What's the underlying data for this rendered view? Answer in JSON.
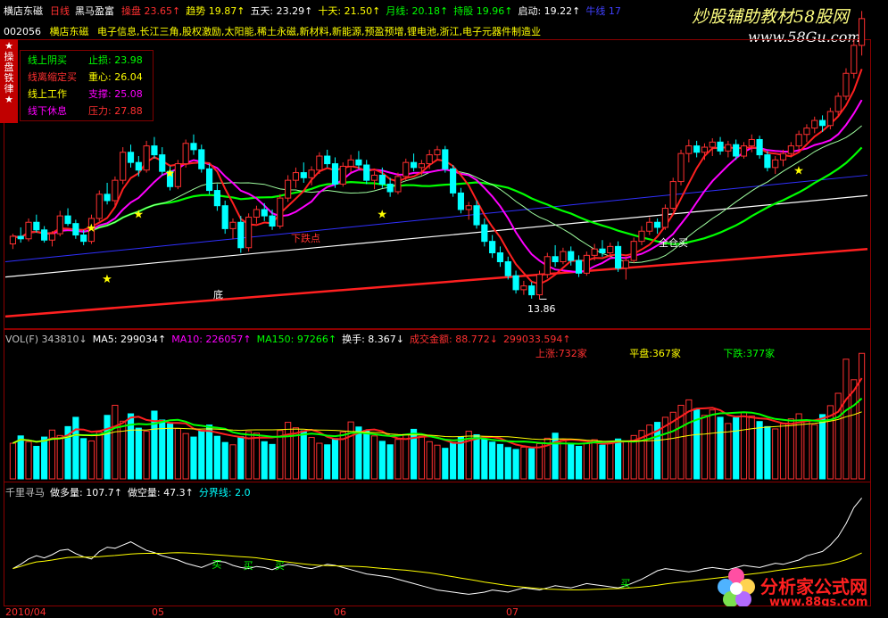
{
  "colors": {
    "up": "#ff3030",
    "down": "#00ffff",
    "bg": "#000000",
    "grid": "#8b0000",
    "white": "#ffffff",
    "yellow": "#ffff00",
    "green": "#00ff00",
    "magenta": "#ff00ff",
    "blue": "#4040ff"
  },
  "topbar": {
    "stock_name": "横店东磁",
    "period": "日线",
    "indicator_name": "黑马盈富",
    "items": [
      {
        "label": "操盘",
        "value": "23.65↑",
        "color": "#ff3030"
      },
      {
        "label": "趋势",
        "value": "19.87↑",
        "color": "#ffff00"
      },
      {
        "label": "五天:",
        "value": "23.29↑",
        "color": "#ffffff"
      },
      {
        "label": "十天:",
        "value": "21.50↑",
        "color": "#ffff00"
      },
      {
        "label": "月线:",
        "value": "20.18↑",
        "color": "#00ff00"
      },
      {
        "label": "持股",
        "value": "19.96↑",
        "color": "#00ff00"
      },
      {
        "label": "启动:",
        "value": "19.22↑",
        "color": "#ffffff"
      },
      {
        "label": "牛线",
        "value": "17",
        "color": "#4040ff"
      }
    ],
    "watermark": "炒股辅助教材58股网",
    "watermark_url": "www.58Gu.com"
  },
  "infobar": {
    "code": "002056",
    "name": "横店东磁",
    "tags": "电子信息,长江三角,股权激励,太阳能,稀土永磁,新材料,新能源,预盈预增,锂电池,浙江,电子元器件制造业"
  },
  "badge": {
    "chars": [
      "★",
      "操",
      "盘",
      "铁",
      "律",
      "★"
    ]
  },
  "rules": [
    {
      "left": "线上阴买",
      "right_label": "止损:",
      "right_value": "23.98",
      "left_color": "#00ff00",
      "right_color": "#00ff00"
    },
    {
      "left": "线离缩定买",
      "right_label": "重心:",
      "right_value": "26.04",
      "left_color": "#ff3030",
      "right_color": "#ffff00"
    },
    {
      "left": "线上工作",
      "right_label": "支撑:",
      "right_value": "25.08",
      "left_color": "#ffff00",
      "right_color": "#ff00ff"
    },
    {
      "left": "线下休息",
      "right_label": "压力:",
      "right_value": "27.88",
      "left_color": "#ff00ff",
      "right_color": "#ff3030"
    }
  ],
  "annotations": {
    "bottom_label": "底",
    "low_price": "13.86",
    "buy_label": "全仓买",
    "other_label": "下跌点",
    "mark_buy": "买"
  },
  "vol_header": {
    "items": [
      {
        "label": "VOL(F)",
        "value": "343810↓",
        "color": "#c0c0c0"
      },
      {
        "label": "MA5:",
        "value": "299034↑",
        "color": "#ffffff"
      },
      {
        "label": "MA10:",
        "value": "226057↑",
        "color": "#ff00ff"
      },
      {
        "label": "MA150:",
        "value": "97266↑",
        "color": "#00ff00"
      },
      {
        "label": "换手:",
        "value": "8.367↓",
        "color": "#ffffff"
      },
      {
        "label": "成交金额:",
        "value": "88.772↓",
        "color": "#ff3030"
      },
      {
        "label": "",
        "value": "299033.594↑",
        "color": "#ff3030"
      }
    ],
    "breadth": [
      {
        "text": "上涨:732家",
        "color": "#ff3030"
      },
      {
        "text": "平盘:367家",
        "color": "#ffff00"
      },
      {
        "text": "下跌:377家",
        "color": "#00ff00"
      }
    ]
  },
  "osc_header": {
    "items": [
      {
        "label": "千里寻马",
        "value": "",
        "color": "#c0c0c0"
      },
      {
        "label": "做多量:",
        "value": "107.7↑",
        "color": "#ffffff"
      },
      {
        "label": "做空量:",
        "value": "47.3↑",
        "color": "#ffffff"
      },
      {
        "label": "分界线:",
        "value": "2.0",
        "color": "#00ffff"
      }
    ],
    "buy_marks": [
      "买",
      "买",
      "买",
      "买"
    ],
    "logo_text": "分析家公式网",
    "logo_url": "www.88gs.com"
  },
  "x_axis": {
    "labels": [
      "2010/04",
      "05",
      "06",
      "07"
    ]
  },
  "chart_data": {
    "type": "candlestick",
    "ylim": [
      12,
      34
    ],
    "candles": [
      [
        18.2,
        19.0,
        17.8,
        18.8
      ],
      [
        18.8,
        19.5,
        18.3,
        18.6
      ],
      [
        18.6,
        20.2,
        18.4,
        19.9
      ],
      [
        19.9,
        20.5,
        19.1,
        19.3
      ],
      [
        19.3,
        19.6,
        18.3,
        18.5
      ],
      [
        18.5,
        19.2,
        18.0,
        19.0
      ],
      [
        19.0,
        20.8,
        18.8,
        20.4
      ],
      [
        20.4,
        21.0,
        19.6,
        19.8
      ],
      [
        19.8,
        20.1,
        18.6,
        18.9
      ],
      [
        18.9,
        19.3,
        18.1,
        18.4
      ],
      [
        18.4,
        20.5,
        18.2,
        20.2
      ],
      [
        20.2,
        22.4,
        20.0,
        22.1
      ],
      [
        22.1,
        23.0,
        21.3,
        21.6
      ],
      [
        21.6,
        23.5,
        21.2,
        23.2
      ],
      [
        23.2,
        25.8,
        22.9,
        25.4
      ],
      [
        25.4,
        26.0,
        24.2,
        24.6
      ],
      [
        24.6,
        25.1,
        23.5,
        24.0
      ],
      [
        24.0,
        26.3,
        23.8,
        25.9
      ],
      [
        25.9,
        26.6,
        24.9,
        25.2
      ],
      [
        25.2,
        25.8,
        23.6,
        23.9
      ],
      [
        23.9,
        24.3,
        22.4,
        22.7
      ],
      [
        22.7,
        24.8,
        22.5,
        24.5
      ],
      [
        24.5,
        26.4,
        24.2,
        26.1
      ],
      [
        26.1,
        26.8,
        25.2,
        25.6
      ],
      [
        25.6,
        26.0,
        23.8,
        24.1
      ],
      [
        24.1,
        24.5,
        22.1,
        22.4
      ],
      [
        22.4,
        22.9,
        20.8,
        21.2
      ],
      [
        21.2,
        21.6,
        19.0,
        19.4
      ],
      [
        19.4,
        20.2,
        18.6,
        19.9
      ],
      [
        19.9,
        20.4,
        17.5,
        17.9
      ],
      [
        17.9,
        20.6,
        17.6,
        20.3
      ],
      [
        20.3,
        21.2,
        19.8,
        20.9
      ],
      [
        20.9,
        21.4,
        20.0,
        20.4
      ],
      [
        20.4,
        20.9,
        19.3,
        19.6
      ],
      [
        19.6,
        22.1,
        19.4,
        21.8
      ],
      [
        21.8,
        23.6,
        21.5,
        23.2
      ],
      [
        23.2,
        24.2,
        22.6,
        23.8
      ],
      [
        23.8,
        24.6,
        23.0,
        23.4
      ],
      [
        23.4,
        24.3,
        22.8,
        24.0
      ],
      [
        24.0,
        25.4,
        23.7,
        25.1
      ],
      [
        25.1,
        25.6,
        24.2,
        24.5
      ],
      [
        24.5,
        25.0,
        22.6,
        22.9
      ],
      [
        22.9,
        24.6,
        22.7,
        24.3
      ],
      [
        24.3,
        25.2,
        23.8,
        24.8
      ],
      [
        24.8,
        25.5,
        24.1,
        24.4
      ],
      [
        24.4,
        24.8,
        22.9,
        23.2
      ],
      [
        23.2,
        23.9,
        22.5,
        23.6
      ],
      [
        23.6,
        24.2,
        22.6,
        22.9
      ],
      [
        22.9,
        23.4,
        21.9,
        22.3
      ],
      [
        22.3,
        23.8,
        22.1,
        23.5
      ],
      [
        23.5,
        24.9,
        23.2,
        24.6
      ],
      [
        24.6,
        25.3,
        23.9,
        24.2
      ],
      [
        24.2,
        24.8,
        23.6,
        24.5
      ],
      [
        24.5,
        25.6,
        24.1,
        25.2
      ],
      [
        25.2,
        25.9,
        24.8,
        25.6
      ],
      [
        25.6,
        25.9,
        23.8,
        24.1
      ],
      [
        24.1,
        24.4,
        21.9,
        22.2
      ],
      [
        22.2,
        22.6,
        20.6,
        20.9
      ],
      [
        20.9,
        21.5,
        20.1,
        21.2
      ],
      [
        21.2,
        21.6,
        19.4,
        19.7
      ],
      [
        19.7,
        20.2,
        18.0,
        18.4
      ],
      [
        18.4,
        18.9,
        17.1,
        17.5
      ],
      [
        17.5,
        18.0,
        16.4,
        16.8
      ],
      [
        16.8,
        17.2,
        15.4,
        15.7
      ],
      [
        15.7,
        16.1,
        14.3,
        14.6
      ],
      [
        14.6,
        15.3,
        14.2,
        14.9
      ],
      [
        14.9,
        15.2,
        13.9,
        14.2
      ],
      [
        14.2,
        16.1,
        13.86,
        15.8
      ],
      [
        15.8,
        17.5,
        15.5,
        17.2
      ],
      [
        17.2,
        18.1,
        16.4,
        16.8
      ],
      [
        16.8,
        17.9,
        16.6,
        17.6
      ],
      [
        17.6,
        18.0,
        16.5,
        16.9
      ],
      [
        16.9,
        17.3,
        15.6,
        15.9
      ],
      [
        15.9,
        17.6,
        15.7,
        17.3
      ],
      [
        17.3,
        18.2,
        16.9,
        17.8
      ],
      [
        17.8,
        18.5,
        17.2,
        17.5
      ],
      [
        17.5,
        18.3,
        17.1,
        18.0
      ],
      [
        18.0,
        18.4,
        16.0,
        16.3
      ],
      [
        16.3,
        17.2,
        15.4,
        16.9
      ],
      [
        16.9,
        18.7,
        16.7,
        18.4
      ],
      [
        18.4,
        19.6,
        18.1,
        19.2
      ],
      [
        19.2,
        20.3,
        18.9,
        19.9
      ],
      [
        19.9,
        20.2,
        19.0,
        19.5
      ],
      [
        19.5,
        21.3,
        19.3,
        21.0
      ],
      [
        21.0,
        23.4,
        20.8,
        23.1
      ],
      [
        23.1,
        25.6,
        22.8,
        25.3
      ],
      [
        25.3,
        26.4,
        24.6,
        25.9
      ],
      [
        25.9,
        26.3,
        25.0,
        25.4
      ],
      [
        25.4,
        26.1,
        24.8,
        25.8
      ],
      [
        25.8,
        26.5,
        25.1,
        26.2
      ],
      [
        26.2,
        26.6,
        25.2,
        25.5
      ],
      [
        25.5,
        26.3,
        25.0,
        26.0
      ],
      [
        26.0,
        26.4,
        24.8,
        25.1
      ],
      [
        25.1,
        26.2,
        24.9,
        25.9
      ],
      [
        25.9,
        26.8,
        25.4,
        26.4
      ],
      [
        26.4,
        26.7,
        24.9,
        25.2
      ],
      [
        25.2,
        25.5,
        23.9,
        24.2
      ],
      [
        24.2,
        25.1,
        23.7,
        24.8
      ],
      [
        24.8,
        25.6,
        24.3,
        25.3
      ],
      [
        25.3,
        26.2,
        25.0,
        25.9
      ],
      [
        25.9,
        27.1,
        25.6,
        26.8
      ],
      [
        26.8,
        27.6,
        26.2,
        27.3
      ],
      [
        27.3,
        28.2,
        26.9,
        27.9
      ],
      [
        27.9,
        28.3,
        27.0,
        27.5
      ],
      [
        27.5,
        28.9,
        27.2,
        28.6
      ],
      [
        28.6,
        30.1,
        28.3,
        29.8
      ],
      [
        29.8,
        32.0,
        29.5,
        31.6
      ],
      [
        31.6,
        34.2,
        31.2,
        33.8
      ],
      [
        33.8,
        36.5,
        33.0,
        35.9
      ]
    ],
    "volumes": [
      9.2,
      11.1,
      9.6,
      8.4,
      10.8,
      12.6,
      11.2,
      13.5,
      15.9,
      10.4,
      9.8,
      12.1,
      16.4,
      19.0,
      14.9,
      16.8,
      13.1,
      12.3,
      17.5,
      15.2,
      14.2,
      13.0,
      11.7,
      10.8,
      12.5,
      13.9,
      11.0,
      9.4,
      8.8,
      10.9,
      12.2,
      11.8,
      9.6,
      8.9,
      12.5,
      14.6,
      13.2,
      12.4,
      10.7,
      9.2,
      8.8,
      10.4,
      12.1,
      14.7,
      13.4,
      12.5,
      11.1,
      9.7,
      8.8,
      10.2,
      11.5,
      12.8,
      10.9,
      9.6,
      8.7,
      7.9,
      9.4,
      10.8,
      12.3,
      11.4,
      10.2,
      9.5,
      8.9,
      8.1,
      7.6,
      8.2,
      7.8,
      9.1,
      10.5,
      11.8,
      10.2,
      9.0,
      8.4,
      9.2,
      10.1,
      8.7,
      9.4,
      10.3,
      9.8,
      11.2,
      12.5,
      13.9,
      14.6,
      15.9,
      17.2,
      19.0,
      20.4,
      18.1,
      16.4,
      17.8,
      15.9,
      14.3,
      15.8,
      17.1,
      16.2,
      14.8,
      13.5,
      12.9,
      14.2,
      15.5,
      16.8,
      15.1,
      14.0,
      16.6,
      18.9,
      22.1,
      30.9,
      25.6,
      32.4
    ],
    "vol_ylim": [
      0,
      32
    ],
    "osc": [
      3.2,
      3.6,
      4.1,
      4.4,
      4.2,
      4.5,
      4.9,
      5.0,
      4.6,
      4.3,
      4.1,
      4.8,
      5.2,
      5.1,
      5.4,
      5.7,
      5.3,
      4.9,
      4.7,
      4.4,
      4.2,
      4.0,
      3.7,
      3.5,
      3.3,
      3.6,
      3.9,
      3.8,
      3.5,
      3.3,
      3.2,
      3.4,
      3.3,
      3.1,
      3.4,
      3.6,
      3.5,
      3.3,
      3.2,
      3.4,
      3.6,
      3.5,
      3.3,
      3.1,
      2.9,
      2.7,
      2.6,
      2.5,
      2.4,
      2.2,
      2.0,
      1.8,
      1.6,
      1.4,
      1.2,
      1.1,
      1.0,
      0.9,
      0.8,
      0.9,
      1.0,
      1.2,
      1.1,
      1.0,
      1.2,
      1.4,
      1.3,
      1.2,
      1.4,
      1.6,
      1.5,
      1.4,
      1.6,
      1.8,
      1.7,
      1.6,
      1.5,
      1.4,
      1.6,
      1.9,
      2.2,
      2.6,
      3.0,
      3.2,
      3.1,
      3.0,
      2.9,
      3.0,
      3.2,
      3.3,
      3.2,
      3.1,
      3.3,
      3.5,
      3.4,
      3.3,
      3.5,
      3.7,
      3.6,
      3.8,
      4.0,
      4.4,
      4.6,
      4.8,
      5.4,
      6.2,
      7.4,
      8.9,
      9.8
    ],
    "osc_baseline": 2.0,
    "osc_ylim": [
      0,
      10
    ]
  }
}
